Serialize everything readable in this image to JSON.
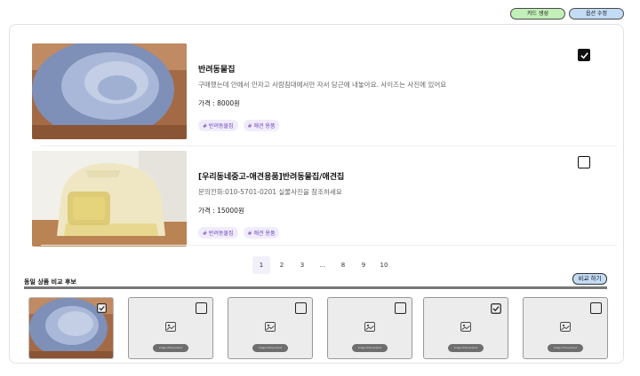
{
  "toolbar": {
    "create_card": "카드 생성",
    "edit_options": "옵션 수정"
  },
  "listings": [
    {
      "title": "반려동물집",
      "description": "구매했는데 안에서 안자고 사람침대에서만 자서 당근에 내놓아요. 사이즈는 사진에 있어요",
      "price": "가격 : 8000원",
      "tags": [
        "# 반려동물집",
        "# 애견 용품"
      ],
      "checked": true
    },
    {
      "title": "[우리동네중고-애견용품]반려동물집/애견집",
      "description": "문의전화:010-5701-0201 실물사진을 참조하세요",
      "price": "가격 : 15000원",
      "tags": [
        "# 반려동물집",
        "# 애견 용품"
      ],
      "checked": false
    }
  ],
  "pagination": [
    "1",
    "2",
    "3",
    "...",
    "8",
    "9",
    "10"
  ],
  "pagination_current": "1",
  "compare": {
    "header": "동일 상품 비교 후보",
    "button": "비교 하기",
    "slot_caption": "image of the product",
    "slots": [
      {
        "filled": true,
        "checked": true
      },
      {
        "filled": false,
        "checked": false
      },
      {
        "filled": false,
        "checked": false
      },
      {
        "filled": false,
        "checked": false
      },
      {
        "filled": false,
        "checked": true
      },
      {
        "filled": false,
        "checked": false
      }
    ]
  },
  "colors": {
    "green_btn": "#c2f0b8",
    "blue_btn": "#c3dcf5",
    "tag_bg": "#f1ecfb",
    "tag_text": "#6a42c0"
  },
  "icons": [
    "checkbox-checked-icon",
    "checkbox-empty-icon",
    "image-placeholder-icon"
  ]
}
